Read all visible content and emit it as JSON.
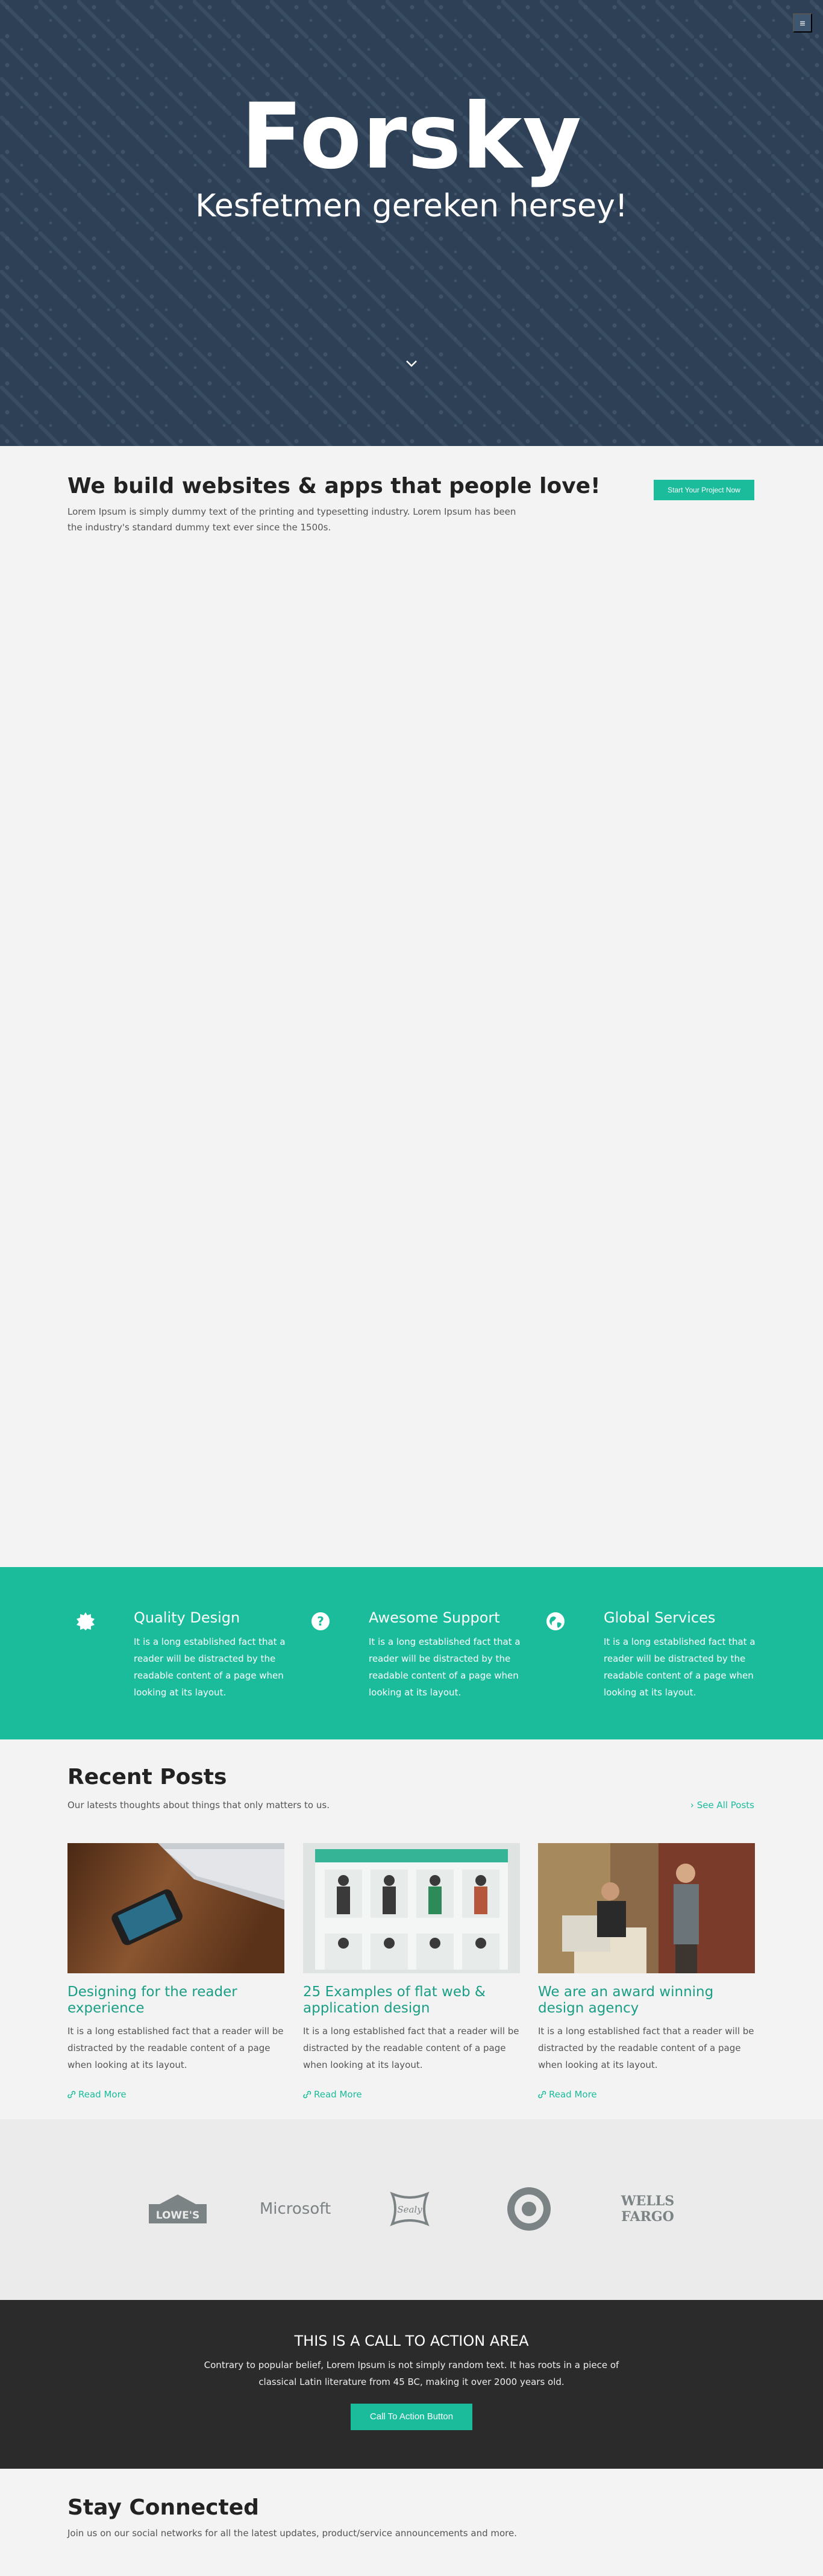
{
  "colors": {
    "hero_bg": "#2d4056",
    "accent": "#1abc9c",
    "cta_bg": "#2b2b2b",
    "clients_bg": "#ebebeb"
  },
  "nav": {
    "menu_icon": "≡"
  },
  "hero": {
    "title": "Forsky",
    "subtitle": "Kesfetmen gereken hersey!",
    "scroll_icon": "chevron-down-icon"
  },
  "intro": {
    "title": "We build websites & apps that people love!",
    "text": "Lorem Ipsum is simply dummy text of the printing and typesetting industry. Lorem Ipsum has been the industry's standard dummy text ever since the 1500s.",
    "button": "Start Your Project Now"
  },
  "features": [
    {
      "icon": "badge-icon",
      "title": "Quality Design",
      "text": "It is a long established fact that a reader will be distracted by the readable content of a page when looking at its layout."
    },
    {
      "icon": "question-icon",
      "title": "Awesome Support",
      "text": "It is a long established fact that a reader will be distracted by the readable content of a page when looking at its layout."
    },
    {
      "icon": "globe-icon",
      "title": "Global Services",
      "text": "It is a long established fact that a reader will be distracted by the readable content of a page when looking at its layout."
    }
  ],
  "recent_posts": {
    "title": "Recent Posts",
    "subtitle": "Our latests thoughts about things that only matters to us.",
    "see_all": "› See All Posts",
    "posts": [
      {
        "title": "Designing for the reader experience",
        "text": "It is a long established fact that a reader will be distracted by the readable content of a page when looking at its layout.",
        "link": "Read More"
      },
      {
        "title": "25 Examples of flat web & application design",
        "text": "It is a long established fact that a reader will be distracted by the readable content of a page when looking at its layout.",
        "link": "Read More"
      },
      {
        "title": "We are an award winning design agency",
        "text": "It is a long established fact that a reader will be distracted by the readable content of a page when looking at its layout.",
        "link": "Read More"
      }
    ]
  },
  "clients": {
    "lowes": "LOWE'S",
    "microsoft": "Microsoft",
    "sealy": "Sealy",
    "target": "target-logo",
    "wells_fargo_1": "WELLS",
    "wells_fargo_2": "FARGO"
  },
  "cta": {
    "title": "THIS IS A CALL TO ACTION AREA",
    "text": "Contrary to popular belief, Lorem Ipsum is not simply random text. It has roots in a piece of classical Latin literature from 45 BC, making it over 2000 years old.",
    "button": "Call To Action Button"
  },
  "stay_connected": {
    "title": "Stay Connected",
    "text": "Join us on our social networks for all the latest updates, product/service announcements and more."
  }
}
